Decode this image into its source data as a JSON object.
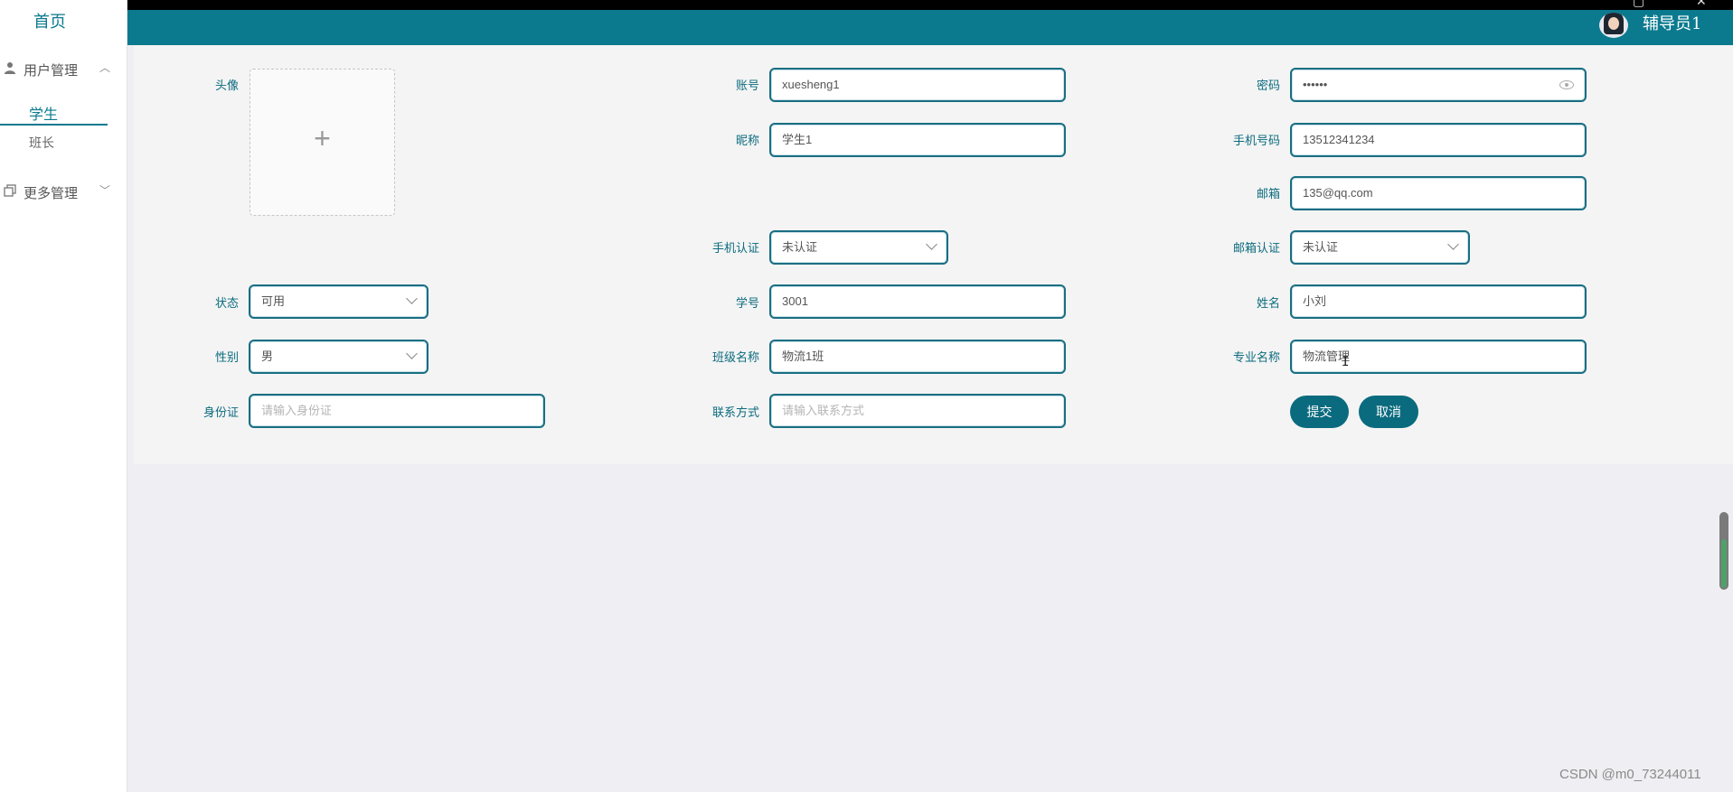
{
  "header": {
    "username": "辅导员1"
  },
  "sidebar": {
    "home": "首页",
    "menus": [
      {
        "label": "用户管理",
        "icon": "user-icon",
        "expanded": true
      },
      {
        "label": "更多管理",
        "icon": "copy-icon",
        "expanded": false
      }
    ],
    "submenu": [
      {
        "label": "学生",
        "active": true
      },
      {
        "label": "班长",
        "active": false
      }
    ]
  },
  "form": {
    "avatar": {
      "label": "头像"
    },
    "account": {
      "label": "账号",
      "value": "xuesheng1"
    },
    "password": {
      "label": "密码",
      "value": "••••••"
    },
    "nickname": {
      "label": "昵称",
      "value": "学生1"
    },
    "phone": {
      "label": "手机号码",
      "value": "13512341234"
    },
    "email": {
      "label": "邮箱",
      "value": "135@qq.com"
    },
    "phone_verify": {
      "label": "手机认证",
      "value": "未认证"
    },
    "email_verify": {
      "label": "邮箱认证",
      "value": "未认证"
    },
    "status": {
      "label": "状态",
      "value": "可用"
    },
    "student_no": {
      "label": "学号",
      "value": "3001"
    },
    "name": {
      "label": "姓名",
      "value": "小刘"
    },
    "gender": {
      "label": "性别",
      "value": "男"
    },
    "class_name": {
      "label": "班级名称",
      "value": "物流1班"
    },
    "major_name": {
      "label": "专业名称",
      "value": "物流管理"
    },
    "id_card": {
      "label": "身份证",
      "placeholder": "请输入身份证"
    },
    "contact": {
      "label": "联系方式",
      "placeholder": "请输入联系方式"
    },
    "submit_label": "提交",
    "cancel_label": "取消"
  },
  "watermark": "CSDN @m0_73244011",
  "colors": {
    "primary": "#0b7a8f",
    "button": "#0b6b7e"
  }
}
